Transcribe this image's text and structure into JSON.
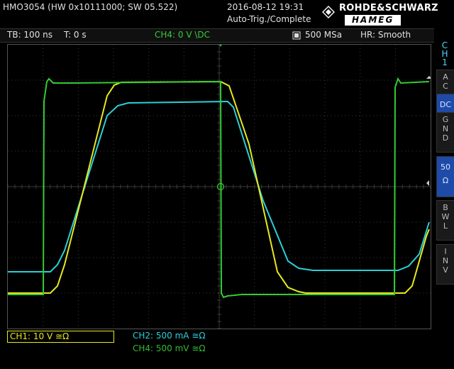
{
  "header": {
    "device_info": "HMO3054 (HW 0x10111000; SW 05.522)",
    "datetime": "2016-08-12 19:31",
    "status": "Auto-Trig./Complete",
    "logo_top": "ROHDE&SCHWARZ",
    "logo_bottom": "HAMEG"
  },
  "status_bar": {
    "timebase": "TB: 100 ns",
    "trigger_time": "T: 0 s",
    "trigger_info": "CH4: 0 V \\DC",
    "sample_rate": "500 MSa",
    "resolution": "HR: Smooth"
  },
  "sidebar": {
    "channel": [
      "C",
      "H",
      "1"
    ],
    "buttons": [
      {
        "label": [
          "A",
          "C"
        ],
        "active": false
      },
      {
        "label": [
          "D",
          "C"
        ],
        "active": true
      },
      {
        "label": [
          "G",
          "N",
          "D"
        ],
        "active": false
      },
      {
        "label": [
          "50",
          "Ω"
        ],
        "active": true
      },
      {
        "label": [
          "B",
          "W",
          "L"
        ],
        "active": false
      },
      {
        "label": [
          "I",
          "N",
          "V"
        ],
        "active": false
      }
    ]
  },
  "channels": {
    "ch1": "CH1: 10 V ≅Ω",
    "ch2": "CH2: 500 mA ≅Ω",
    "ch4": "CH4: 500 mV ≅Ω"
  },
  "colors": {
    "ch1": "#e8e820",
    "ch2": "#2ad0d8",
    "ch4": "#33cc33",
    "grid": "#3a3a3a",
    "active_button": "#1e4aa8"
  }
}
